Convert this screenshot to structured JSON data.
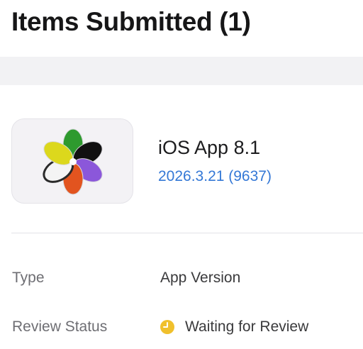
{
  "header": {
    "title": "Items Submitted (1)"
  },
  "item": {
    "app_name": "iOS App 8.1",
    "version": "2026.3.21 (9637)",
    "icon": "flower-petals-app-icon",
    "colors": {
      "version_link": "#3478d6",
      "petals": [
        "#2e9a2e",
        "#0f0f0f",
        "#8a56d9",
        "#e2541f",
        "#f2f2f2",
        "#d9d61c"
      ]
    }
  },
  "details": {
    "type": {
      "label": "Type",
      "value": "App Version"
    },
    "review_status": {
      "label": "Review Status",
      "value": "Waiting for Review",
      "icon": "clock-icon",
      "icon_color": "#f0c02c"
    }
  }
}
